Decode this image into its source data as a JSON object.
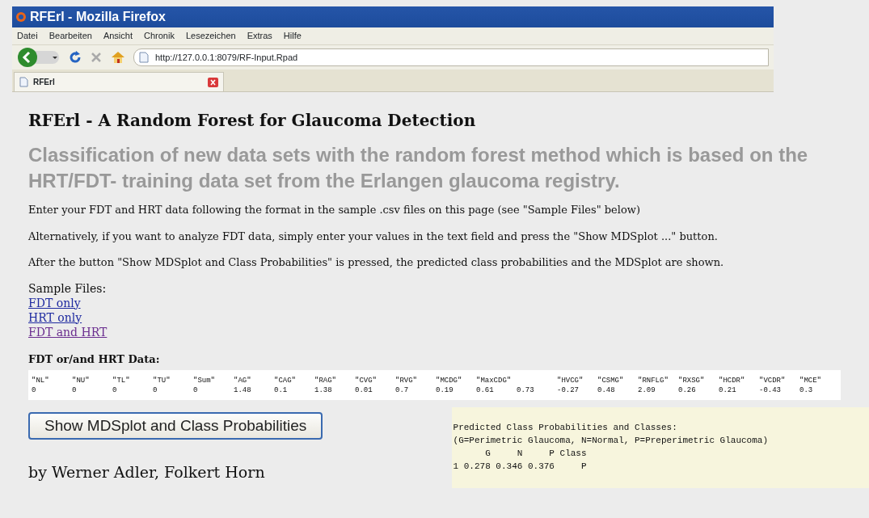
{
  "window": {
    "title": "RFErl - Mozilla Firefox"
  },
  "menu": [
    "Datei",
    "Bearbeiten",
    "Ansicht",
    "Chronik",
    "Lesezeichen",
    "Extras",
    "Hilfe"
  ],
  "address": "http://127.0.0.1:8079/RF-Input.Rpad",
  "tabs": [
    {
      "label": "RFErl",
      "selected": true
    }
  ],
  "heading": "RFErl - A Random Forest for Glaucoma Detection",
  "subheading": "Classification of new data sets with the random forest method which is based on the HRT/FDT- training data set from the Erlangen glaucoma registry.",
  "paragraphs": [
    "Enter your FDT and HRT data following the format in the sample .csv files on this page (see \"Sample Files\" below)",
    "Alternatively, if you want to analyze FDT data, simply enter your values in the text field and press the \"Show MDSplot ...\" button.",
    "After the button \"Show MDSplot and Class Probabilities\" is pressed, the predicted class probabilities and the MDSplot are shown."
  ],
  "sample_files": {
    "label": "Sample Files:",
    "links": [
      {
        "label": "FDT only",
        "visited": false
      },
      {
        "label": "HRT only",
        "visited": false
      },
      {
        "label": "FDT and HRT",
        "visited": true
      }
    ]
  },
  "data_label": "FDT or/and HRT Data:",
  "data_columns": [
    {
      "header": "\"NL\"",
      "value": "0"
    },
    {
      "header": "\"NU\"",
      "value": "0"
    },
    {
      "header": "\"TL\"",
      "value": "0"
    },
    {
      "header": "\"TU\"",
      "value": "0"
    },
    {
      "header": "\"Sum\"",
      "value": "0"
    },
    {
      "header": "\"AG\"",
      "value": "1.48"
    },
    {
      "header": "\"CAG\"",
      "value": "0.1"
    },
    {
      "header": "\"RAG\"",
      "value": "1.38"
    },
    {
      "header": "\"CVG\"",
      "value": "0.01"
    },
    {
      "header": "\"RVG\"",
      "value": "0.7"
    },
    {
      "header": "\"MCDG\"",
      "value": "0.19"
    },
    {
      "header": "\"MaxCDG\"",
      "value": "0.61"
    },
    {
      "value": "0.73"
    },
    {
      "header": "\"HVCG\"",
      "value": "-0.27"
    },
    {
      "header": "\"CSMG\"",
      "value": "0.48"
    },
    {
      "header": "\"RNFLG\"",
      "value": "2.09"
    },
    {
      "header": "\"RXSG\"",
      "value": "0.26"
    },
    {
      "header": "\"HCDR\"",
      "value": "0.21"
    },
    {
      "header": "\"VCDR\"",
      "value": "-0.43"
    },
    {
      "header": "\"MCE\"",
      "value": "0.3"
    }
  ],
  "button": "Show MDSplot and Class Probabilities",
  "authors": "by Werner Adler, Folkert Horn",
  "result_lines": [
    "Predicted Class Probabilities and Classes:",
    "(G=Perimetric Glaucoma, N=Normal, P=Preperimetric Glaucoma)",
    "      G     N     P Class",
    "1 0.278 0.346 0.376     P"
  ]
}
